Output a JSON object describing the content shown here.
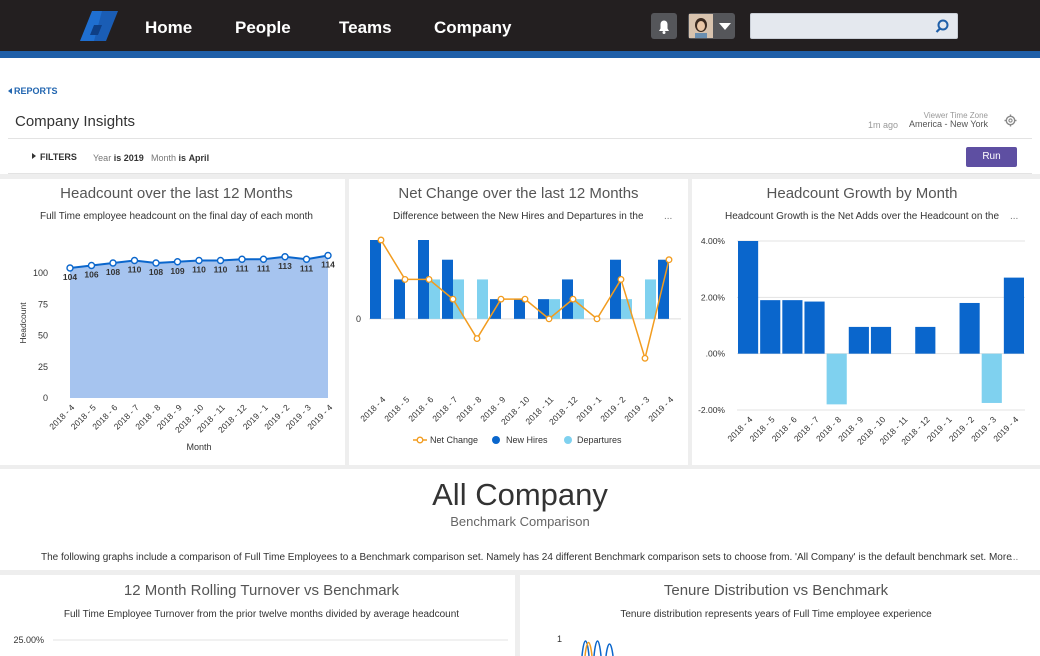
{
  "nav": {
    "items": [
      "Home",
      "People",
      "Teams",
      "Company"
    ],
    "search_placeholder": ""
  },
  "colors": {
    "accent_blue": "#0a66cc",
    "light_blue": "#7fd1ef",
    "orange": "#f29c1f",
    "area_fill": "#a6c4ef",
    "run_button": "#5e4fa2"
  },
  "breadcrumb": "REPORTS",
  "page_title": "Company Insights",
  "meta": {
    "updated": "1m ago",
    "timezone_label": "Viewer Time Zone",
    "timezone_value": "America - New York"
  },
  "filters": {
    "label": "FILTERS",
    "year_key": "Year",
    "year_op": "is",
    "year_val": "2019",
    "month_key": "Month",
    "month_op": "is",
    "month_val": "April",
    "run_label": "Run"
  },
  "panels": {
    "headcount": {
      "title": "Headcount over the last 12 Months",
      "subtitle": "Full Time employee headcount on the final day of each month"
    },
    "net_change": {
      "title": "Net Change over the last 12 Months",
      "subtitle": "Difference between the New Hires and Departures in the",
      "more": "..."
    },
    "growth": {
      "title": "Headcount Growth by Month",
      "subtitle": "Headcount Growth is the Net Adds over the Headcount on the",
      "more": "..."
    },
    "turnover": {
      "title": "12 Month Rolling Turnover vs Benchmark",
      "subtitle": "Full Time Employee Turnover from the prior twelve months divided by average headcount"
    },
    "tenure": {
      "title": "Tenure Distribution vs Benchmark",
      "subtitle": "Tenure distribution represents years of Full Time employee experience"
    }
  },
  "section": {
    "title": "All Company",
    "subtitle": "Benchmark Comparison",
    "blurb": "The following graphs include a comparison of Full Time Employees to a Benchmark comparison set. Namely has 24 different Benchmark comparison sets to choose from. 'All Company' is the default benchmark set. More",
    "blurb_more": "..."
  },
  "chart_data": [
    {
      "type": "area",
      "title": "Headcount over the last 12 Months",
      "xlabel": "Month",
      "ylabel": "Headcount",
      "categories": [
        "2018 - 4",
        "2018 - 5",
        "2018 - 6",
        "2018 - 7",
        "2018 - 8",
        "2018 - 9",
        "2018 - 10",
        "2018 - 11",
        "2018 - 12",
        "2019 - 1",
        "2019 - 2",
        "2019 - 3",
        "2019 - 4"
      ],
      "values": [
        104,
        106,
        108,
        110,
        108,
        109,
        110,
        110,
        111,
        111,
        113,
        111,
        114
      ],
      "yticks": [
        0,
        25,
        50,
        75,
        100
      ],
      "ylim": [
        0,
        120
      ]
    },
    {
      "type": "bar",
      "title": "Net Change over the last 12 Months",
      "categories": [
        "2018 - 4",
        "2018 - 5",
        "2018 - 6",
        "2018 - 7",
        "2018 - 8",
        "2018 - 9",
        "2018 - 10",
        "2018 - 11",
        "2018 - 12",
        "2019 - 1",
        "2019 - 2",
        "2019 - 3",
        "2019 - 4"
      ],
      "yticks": [
        0
      ],
      "ylim": [
        -3,
        4
      ],
      "series": [
        {
          "name": "Net Change",
          "type": "line",
          "values": [
            4,
            2,
            2,
            1,
            -1,
            1,
            1,
            0,
            1,
            0,
            2,
            -2,
            3
          ]
        },
        {
          "name": "New Hires",
          "type": "bar",
          "values": [
            4,
            2,
            4,
            3,
            0,
            1,
            1,
            1,
            2,
            0,
            3,
            0,
            3
          ]
        },
        {
          "name": "Departures",
          "type": "bar",
          "values": [
            0,
            0,
            2,
            2,
            2,
            0,
            0,
            1,
            1,
            0,
            1,
            2,
            0
          ]
        }
      ],
      "legend": "bottom"
    },
    {
      "type": "bar",
      "title": "Headcount Growth by Month",
      "categories": [
        "2018 - 4",
        "2018 - 5",
        "2018 - 6",
        "2018 - 7",
        "2018 - 8",
        "2018 - 9",
        "2018 - 10",
        "2018 - 11",
        "2018 - 12",
        "2019 - 1",
        "2019 - 2",
        "2019 - 3",
        "2019 - 4"
      ],
      "values": [
        4.0,
        1.9,
        1.9,
        1.85,
        -1.8,
        0.95,
        0.95,
        0,
        0.95,
        0,
        1.8,
        -1.75,
        2.7
      ],
      "yticks": [
        "4.00%",
        "2.00%",
        ".00%",
        "-2.00%"
      ],
      "ylim": [
        -2.0,
        4.0
      ]
    },
    {
      "type": "line",
      "title": "12 Month Rolling Turnover vs Benchmark",
      "yticks": [
        "25.00%"
      ]
    },
    {
      "type": "line",
      "title": "Tenure Distribution vs Benchmark",
      "yticks": [
        "1"
      ]
    }
  ]
}
